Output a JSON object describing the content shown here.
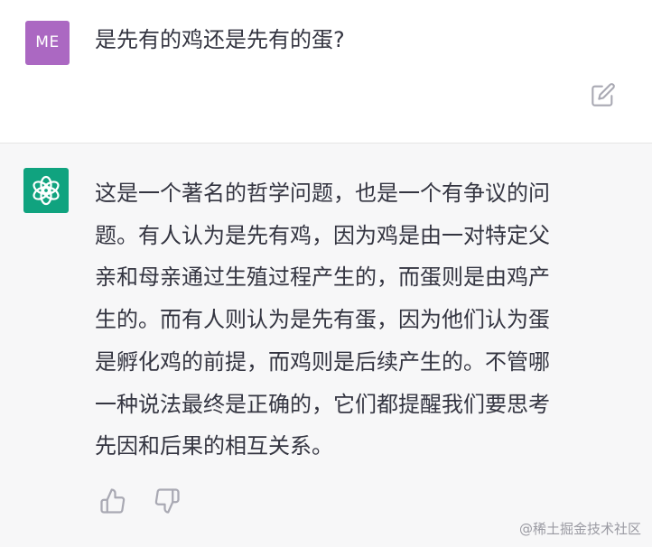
{
  "user": {
    "avatar_text": "ME",
    "question": "是先有的鸡还是先有的蛋?",
    "avatar_color": "#ab68c2"
  },
  "assistant": {
    "avatar_icon": "openai-logo-icon",
    "avatar_color": "#10a37f",
    "answer_lines": [
      "这是一个著名的哲学问题，也是一个有争议的问",
      "题。有人认为是先有鸡，因为鸡是由一对特定父",
      "亲和母亲通过生殖过程产生的，而蛋则是由鸡产",
      "生的。而有人则认为是先有蛋，因为他们认为蛋",
      "是孵化鸡的前提，而鸡则是后续产生的。不管哪",
      "一种说法最终是正确的，它们都提醒我们要思考",
      "先因和后果的相互关系。"
    ]
  },
  "actions": {
    "edit_icon": "edit-icon",
    "thumbs_up_icon": "thumbs-up-icon",
    "thumbs_down_icon": "thumbs-down-icon"
  },
  "watermark": "@稀土掘金技术社区"
}
